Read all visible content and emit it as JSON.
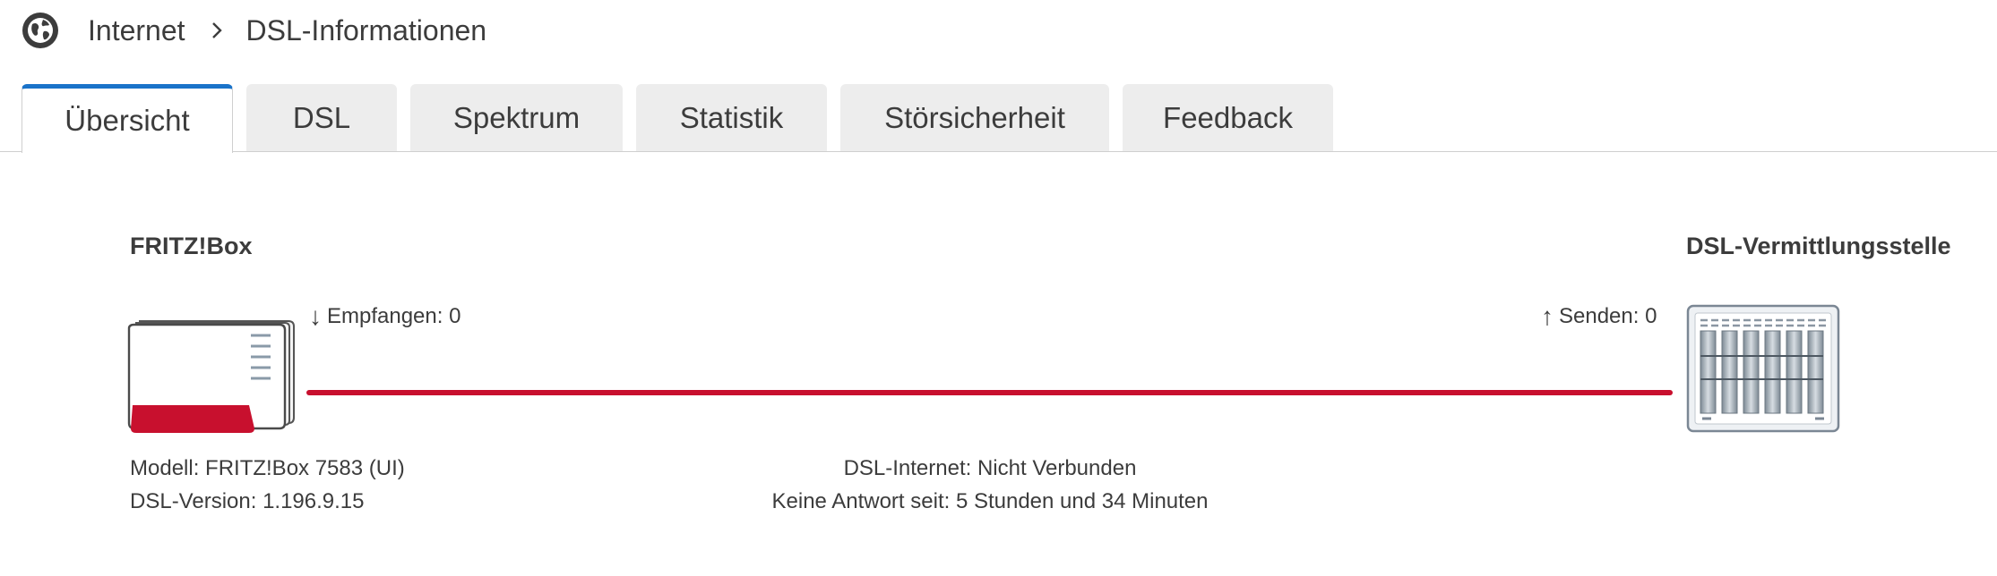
{
  "breadcrumb": {
    "icon": "globe-icon",
    "items": [
      "Internet",
      "DSL-Informationen"
    ]
  },
  "tabs": [
    {
      "label": "Übersicht",
      "active": true
    },
    {
      "label": "DSL",
      "active": false
    },
    {
      "label": "Spektrum",
      "active": false
    },
    {
      "label": "Statistik",
      "active": false
    },
    {
      "label": "Störsicherheit",
      "active": false
    },
    {
      "label": "Feedback",
      "active": false
    }
  ],
  "overview": {
    "fritzbox_title": "FRITZ!Box",
    "exchange_title": "DSL-Vermittlungsstelle",
    "downstream": "Empfangen: 0",
    "upstream": "Senden: 0",
    "model": "Modell: FRITZ!Box 7583 (UI)",
    "dsl_version": "DSL-Version: 1.196.9.15",
    "connection_status": "DSL-Internet: Nicht Verbunden",
    "no_response": "Keine Antwort seit: 5 Stunden und 34 Minuten",
    "line_color": "#c8102e"
  },
  "colors": {
    "accent": "#1a73c9",
    "router_red": "#c8102e",
    "text": "#3c3c3c",
    "tab_bg": "#ededed"
  }
}
